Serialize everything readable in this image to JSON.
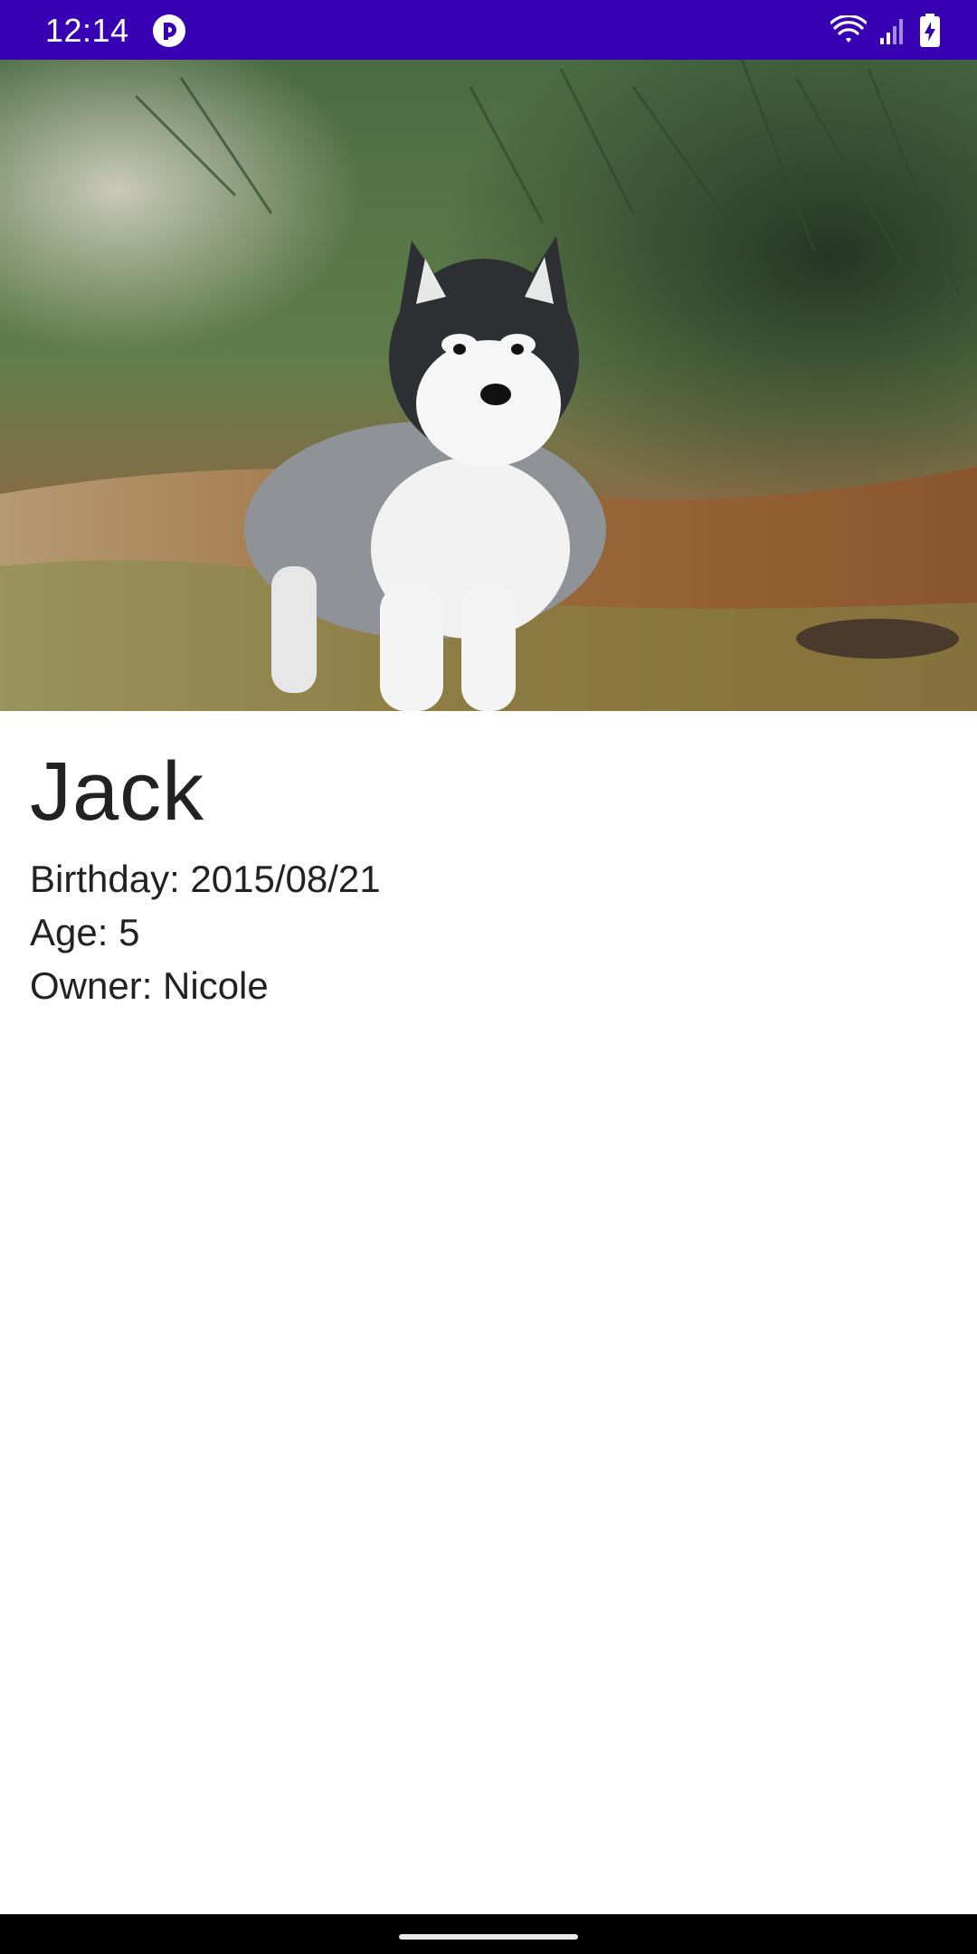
{
  "status_bar": {
    "time": "12:14",
    "app_icon": "pocket-casts-icon",
    "icons": [
      "wifi-icon",
      "cell-signal-icon",
      "battery-charging-icon"
    ],
    "background_color": "#3700b3"
  },
  "hero": {
    "image_description": "husky puppy standing on grass under pine branches"
  },
  "pet": {
    "name": "Jack",
    "birthday": "Birthday: 2015/08/21",
    "age": "Age: 5",
    "owner": "Owner: Nicole"
  },
  "colors": {
    "text": "#222222",
    "status_bar": "#3700b3",
    "nav_bar": "#000000"
  }
}
